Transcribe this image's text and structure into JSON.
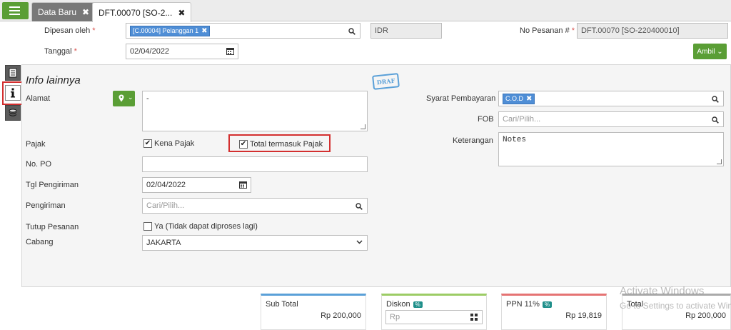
{
  "tabs": [
    {
      "label": "Data Baru",
      "close": "✖"
    },
    {
      "label": "DFT.00070 [SO-2...",
      "close": "✖"
    }
  ],
  "header": {
    "customer_label": "Dipesan oleh",
    "customer_value": "[C.00004] Pelanggan 1",
    "currency": "IDR",
    "order_no_label": "No Pesanan #",
    "order_no_value": "DFT.00070 [SO-220400010]",
    "date_label": "Tanggal",
    "date_value": "02/04/2022",
    "ambil_label": "Ambil",
    "required_mark": "*"
  },
  "panel": {
    "title": "Info lainnya",
    "stamp": "DRAF",
    "address_label": "Alamat",
    "address_value": "-",
    "tax_label": "Pajak",
    "tax_option": "Kena Pajak",
    "tax_inclusive_option": "Total termasuk Pajak",
    "po_label": "No. PO",
    "po_value": "",
    "ship_date_label": "Tgl Pengiriman",
    "ship_date_value": "02/04/2022",
    "shipping_label": "Pengiriman",
    "shipping_placeholder": "Cari/Pilih...",
    "close_order_label": "Tutup Pesanan",
    "close_order_option": "Ya (Tidak dapat diproses lagi)",
    "branch_label": "Cabang",
    "branch_value": "JAKARTA",
    "payment_terms_label": "Syarat Pembayaran",
    "payment_terms_value": "C.O.D",
    "fob_label": "FOB",
    "fob_placeholder": "Cari/Pilih...",
    "notes_label": "Keterangan",
    "notes_value": "Notes"
  },
  "totals": {
    "subtotal_label": "Sub Total",
    "subtotal_value": "Rp 200,000",
    "discount_label": "Diskon",
    "discount_badge": "%",
    "discount_placeholder": "Rp",
    "tax_label": "PPN 11%",
    "tax_badge": "%",
    "tax_value": "Rp 19,819",
    "total_label": "Total",
    "total_value": "Rp 200,000"
  },
  "watermark": {
    "line1": "Activate Windows",
    "line2": "Go to Settings to activate Windows."
  },
  "colors": {
    "primary_green": "#5a9e35",
    "chip_blue": "#4f8ed6",
    "highlight_red": "#d32f2f",
    "badge_teal": "#1f8f8a"
  }
}
